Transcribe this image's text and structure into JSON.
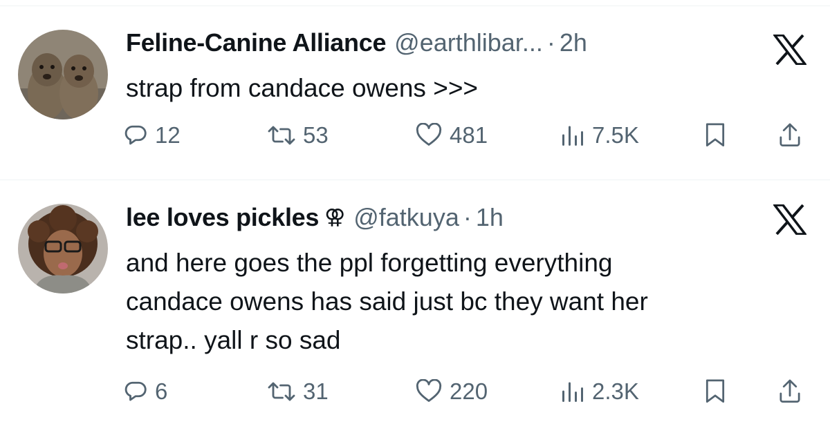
{
  "colors": {
    "text_primary": "#0f1419",
    "text_secondary": "#536471",
    "divider": "#eff3f4",
    "background": "#ffffff"
  },
  "tweets": [
    {
      "display_name": "Feline-Canine Alliance",
      "badge_icon": "",
      "handle": "@earthlibar...",
      "separator": "·",
      "time": "2h",
      "text": "strap from candace owens >>>",
      "avatar_icon": "avatar-two-animals",
      "stats": {
        "replies": "12",
        "reposts": "53",
        "likes": "481",
        "views": "7.5K"
      }
    },
    {
      "display_name": "lee loves pickles",
      "badge_icon": "⚢",
      "handle": "@fatkuya",
      "separator": "·",
      "time": "1h",
      "text": "and here goes the ppl forgetting everything\ncandace owens has said just bc they want her\nstrap.. yall r so sad",
      "avatar_icon": "avatar-person-glasses",
      "stats": {
        "replies": "6",
        "reposts": "31",
        "likes": "220",
        "views": "2.3K"
      }
    }
  ]
}
